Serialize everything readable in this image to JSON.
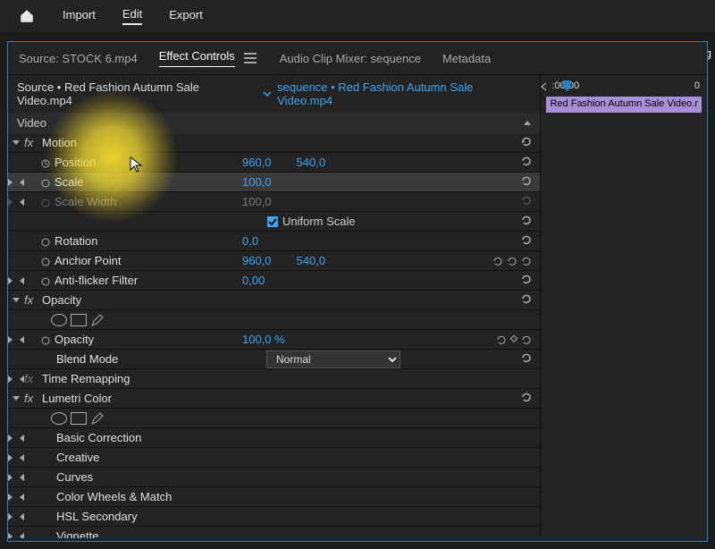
{
  "topMenu": {
    "tabs": [
      "Import",
      "Edit",
      "Export"
    ],
    "activeIndex": 1
  },
  "panelTabs": {
    "source": "Source: STOCK 6.mp4",
    "effectControls": "Effect Controls",
    "audioMixer": "Audio Clip Mixer: sequence",
    "metadata": "Metadata"
  },
  "sourceRow": {
    "source": "Source • Red Fashion Autumn Sale Video.mp4",
    "sequence": "sequence • Red Fashion Autumn Sale Video.mp4"
  },
  "videoHeader": "Video",
  "effects": {
    "motion": {
      "title": "Motion",
      "position": {
        "label": "Position",
        "x": "960,0",
        "y": "540,0"
      },
      "scale": {
        "label": "Scale",
        "v": "100,0"
      },
      "scaleWidth": {
        "label": "Scale Width",
        "v": "100,0"
      },
      "uniformScale": "Uniform Scale",
      "rotation": {
        "label": "Rotation",
        "v": "0,0"
      },
      "anchor": {
        "label": "Anchor Point",
        "x": "960,0",
        "y": "540,0"
      },
      "antiFlicker": {
        "label": "Anti-flicker Filter",
        "v": "0,00"
      }
    },
    "opacity": {
      "title": "Opacity",
      "opacity": {
        "label": "Opacity",
        "v": "100,0 %"
      },
      "blendMode": {
        "label": "Blend Mode",
        "v": "Normal"
      }
    },
    "timeRemap": "Time Remapping",
    "lumetri": {
      "title": "Lumetri Color",
      "items": [
        "Basic Correction",
        "Creative",
        "Curves",
        "Color Wheels & Match",
        "HSL Secondary",
        "Vignette"
      ]
    }
  },
  "timeline": {
    "start": ":00:00",
    "end": "0",
    "clipName": "Red Fashion Autumn Sale Video.r"
  },
  "progPanel": "Prog"
}
